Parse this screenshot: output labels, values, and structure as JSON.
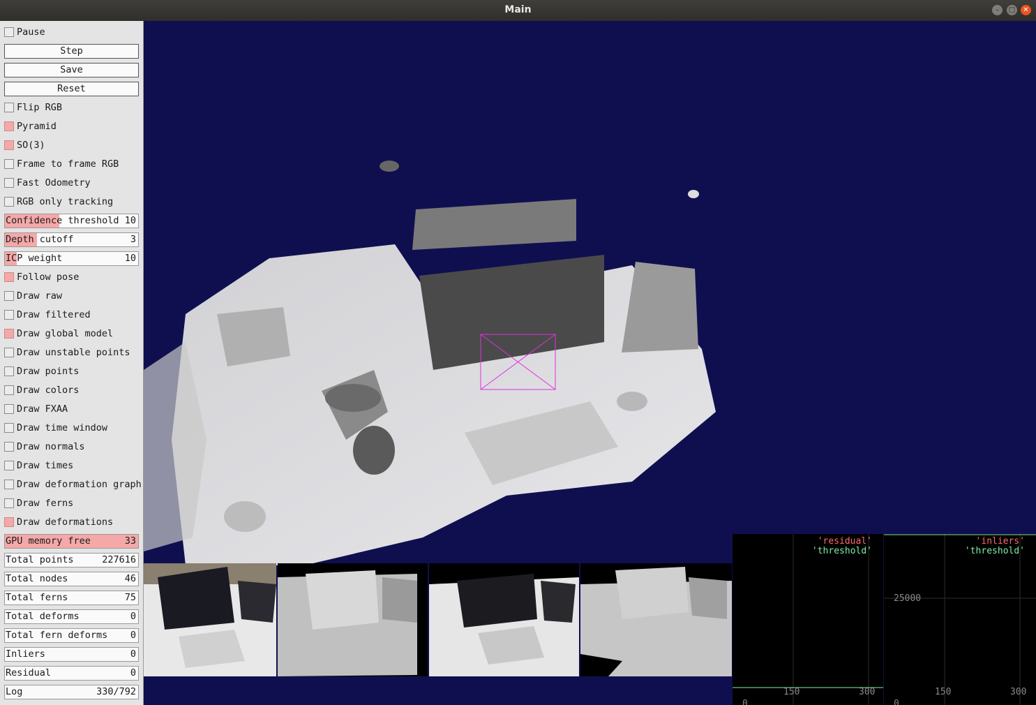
{
  "window": {
    "title": "Main"
  },
  "controls": {
    "pause": {
      "label": "Pause",
      "checked": false
    },
    "step": "Step",
    "save": "Save",
    "reset": "Reset",
    "flip_rgb": {
      "label": "Flip RGB",
      "checked": false
    },
    "pyramid": {
      "label": "Pyramid",
      "checked": true
    },
    "so3": {
      "label": "SO(3)",
      "checked": true
    },
    "frame_to_frame_rgb": {
      "label": "Frame to frame RGB",
      "checked": false
    },
    "fast_odometry": {
      "label": "Fast Odometry",
      "checked": false
    },
    "rgb_only_tracking": {
      "label": "RGB only tracking",
      "checked": false
    },
    "confidence_threshold": {
      "label": "Confidence threshold",
      "value": "10",
      "fill": 0.41
    },
    "depth_cutoff": {
      "label": "Depth cutoff",
      "value": "3",
      "fill": 0.24
    },
    "icp_weight": {
      "label": "ICP weight",
      "value": "10",
      "fill": 0.09
    },
    "follow_pose": {
      "label": "Follow pose",
      "checked": true
    },
    "draw_raw": {
      "label": "Draw raw",
      "checked": false
    },
    "draw_filtered": {
      "label": "Draw filtered",
      "checked": false
    },
    "draw_global_model": {
      "label": "Draw global model",
      "checked": true
    },
    "draw_unstable_points": {
      "label": "Draw unstable points",
      "checked": false
    },
    "draw_points": {
      "label": "Draw points",
      "checked": false
    },
    "draw_colors": {
      "label": "Draw colors",
      "checked": false
    },
    "draw_fxaa": {
      "label": "Draw FXAA",
      "checked": false
    },
    "draw_time_window": {
      "label": "Draw time window",
      "checked": false
    },
    "draw_normals": {
      "label": "Draw normals",
      "checked": false
    },
    "draw_times": {
      "label": "Draw times",
      "checked": false
    },
    "draw_deformation_graph": {
      "label": "Draw deformation graph",
      "checked": false
    },
    "draw_ferns": {
      "label": "Draw ferns",
      "checked": false
    },
    "draw_deformations": {
      "label": "Draw deformations",
      "checked": true
    }
  },
  "stats": {
    "gpu_memory_free": {
      "label": "GPU memory free",
      "value": "33",
      "fill": 1.0
    },
    "total_points": {
      "label": "Total points",
      "value": "227616"
    },
    "total_nodes": {
      "label": "Total nodes",
      "value": "46"
    },
    "total_ferns": {
      "label": "Total ferns",
      "value": "75"
    },
    "total_deforms": {
      "label": "Total deforms",
      "value": "0"
    },
    "total_fern_deforms": {
      "label": "Total fern deforms",
      "value": "0"
    },
    "inliers": {
      "label": "Inliers",
      "value": "0"
    },
    "residual": {
      "label": "Residual",
      "value": "0"
    },
    "log": {
      "label": "Log",
      "value": "330/792"
    }
  },
  "plots": {
    "residual": {
      "legend": [
        "'residual'",
        "'threshold'"
      ],
      "xticks": [
        "150",
        "300"
      ],
      "ytick_bottom": "0"
    },
    "inliers": {
      "legend": [
        "'inliers'",
        "'threshold'"
      ],
      "ytick": "25000",
      "xticks": [
        "150",
        "300"
      ],
      "ytick_bottom": "0"
    }
  },
  "colors": {
    "background": "#0f0f50",
    "checked": "#f5a8a8",
    "residual": "#ff6b6b",
    "threshold": "#7cf0a8",
    "inliers": "#ff6b6b",
    "camera": "#e030e0"
  }
}
